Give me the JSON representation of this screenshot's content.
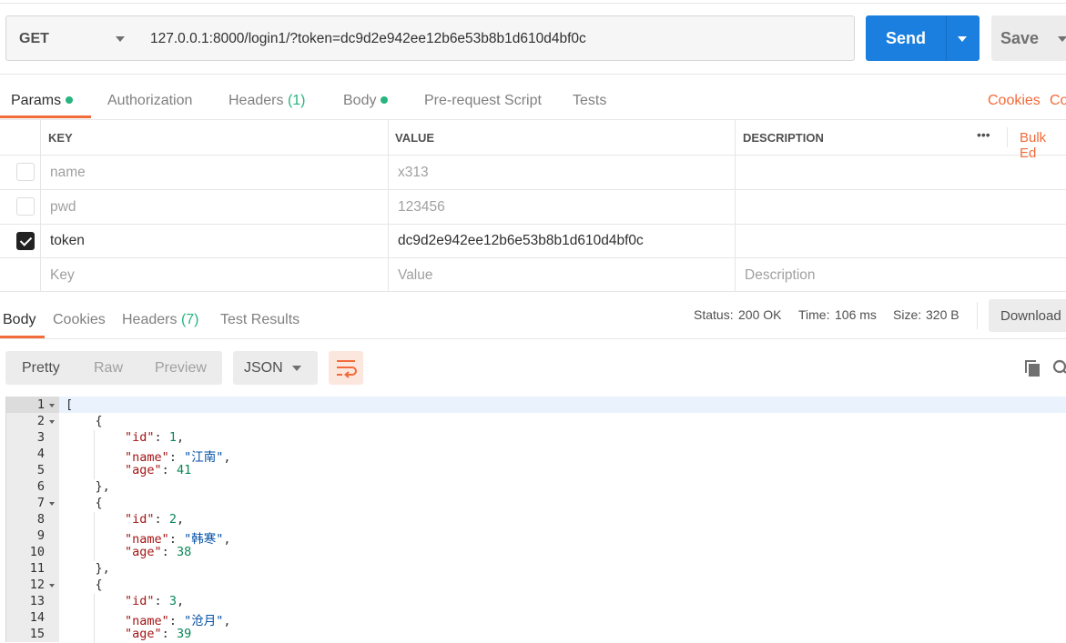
{
  "request": {
    "method": "GET",
    "url": "127.0.0.1:8000/login1/?token=dc9d2e942ee12b6e53b8b1d610d4bf0c",
    "send_label": "Send",
    "save_label": "Save"
  },
  "request_tabs": {
    "params": "Params",
    "authorization": "Authorization",
    "headers": "Headers",
    "headers_count": "(1)",
    "body": "Body",
    "prerequest": "Pre-request Script",
    "tests": "Tests",
    "cookies": "Cookies",
    "code": "Co"
  },
  "params_table": {
    "col_key": "KEY",
    "col_value": "VALUE",
    "col_description": "DESCRIPTION",
    "more": "•••",
    "bulk_edit": "Bulk Ed",
    "rows": [
      {
        "key": "name",
        "value": "x313",
        "description": "",
        "checked": false
      },
      {
        "key": "pwd",
        "value": "123456",
        "description": "",
        "checked": false
      },
      {
        "key": "token",
        "value": "dc9d2e942ee12b6e53b8b1d610d4bf0c",
        "description": "",
        "checked": true
      }
    ],
    "placeholder_key": "Key",
    "placeholder_value": "Value",
    "placeholder_description": "Description"
  },
  "response_tabs": {
    "body": "Body",
    "cookies": "Cookies",
    "headers": "Headers",
    "headers_count": "(7)",
    "test_results": "Test Results"
  },
  "response_status": {
    "status_label": "Status:",
    "status_value": "200 OK",
    "time_label": "Time:",
    "time_value": "106 ms",
    "size_label": "Size:",
    "size_value": "320 B",
    "download_label": "Download"
  },
  "view": {
    "pretty": "Pretty",
    "raw": "Raw",
    "preview": "Preview",
    "format": "JSON"
  },
  "response_body": {
    "line_numbers": [
      "1",
      "2",
      "3",
      "4",
      "5",
      "6",
      "7",
      "8",
      "9",
      "10",
      "11",
      "12",
      "13",
      "14",
      "15"
    ],
    "records": [
      {
        "id": "1",
        "name": "\"江南\"",
        "age": "41"
      },
      {
        "id": "2",
        "name": "\"韩寒\"",
        "age": "38"
      },
      {
        "id": "3",
        "name": "\"沧月\"",
        "age": "39"
      }
    ]
  },
  "colors": {
    "accent_orange": "#f26b3a",
    "send_blue": "#1a7fde",
    "status_green": "#26b47f"
  }
}
